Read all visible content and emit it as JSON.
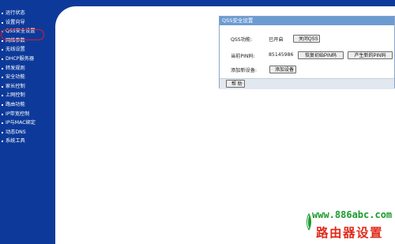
{
  "sidebar": {
    "items": [
      {
        "label": "运行状态"
      },
      {
        "label": "设置向导"
      },
      {
        "label": "QSS安全设置"
      },
      {
        "label": "网络参数"
      },
      {
        "label": "无线设置"
      },
      {
        "label": "DHCP服务器"
      },
      {
        "label": "转发规则"
      },
      {
        "label": "安全功能"
      },
      {
        "label": "家长控制"
      },
      {
        "label": "上网控制"
      },
      {
        "label": "路由功能"
      },
      {
        "label": "IP带宽控制"
      },
      {
        "label": "IP与MAC绑定"
      },
      {
        "label": "动态DNS"
      },
      {
        "label": "系统工具"
      }
    ],
    "selected_index": 2
  },
  "panel": {
    "title": "QSS安全设置",
    "qss_label": "QSS功能:",
    "qss_status": "已开启",
    "qss_toggle_button": "关闭QSS",
    "pin_label": "当前PIN码:",
    "pin_value": "85145986",
    "restore_pin_button": "恢复初始PIN码",
    "new_pin_button": "产生新的PIN码",
    "add_device_label": "添加新设备:",
    "add_device_button": "添加设备",
    "help_button": "帮 助"
  },
  "watermark": {
    "url": "www.886abc.com",
    "text": "路由器设置"
  },
  "colors": {
    "sidebar_bg": "#0d3a9a",
    "panel_title_bg": "#6b9bd1",
    "highlight": "#e0182a",
    "watermark_green": "#1d9a2e",
    "watermark_red": "#e02b1b"
  }
}
